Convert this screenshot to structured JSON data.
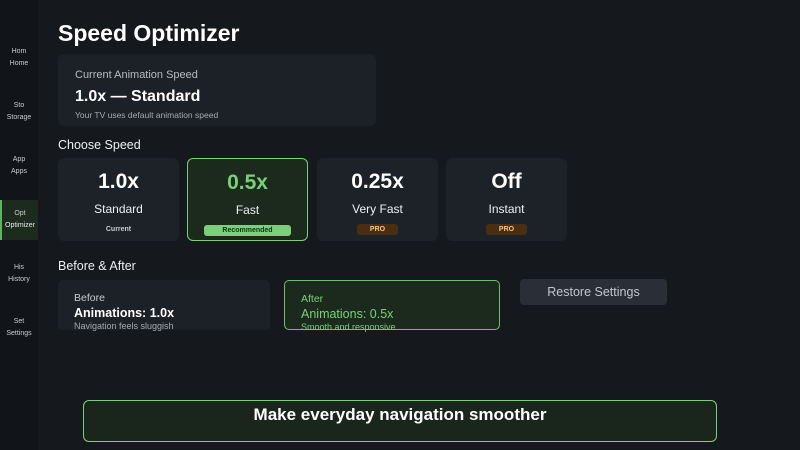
{
  "sidebar": {
    "items": [
      {
        "icon": "Hom",
        "label": "Home",
        "active": false
      },
      {
        "icon": "Sto",
        "label": "Storage",
        "active": false
      },
      {
        "icon": "App",
        "label": "Apps",
        "active": false
      },
      {
        "icon": "Opt",
        "label": "Optimizer",
        "active": true
      },
      {
        "icon": "His",
        "label": "History",
        "active": false
      },
      {
        "icon": "Set",
        "label": "Settings",
        "active": false
      }
    ]
  },
  "page_title": "Speed Optimizer",
  "current": {
    "label": "Current Animation Speed",
    "value": "1.0x — Standard",
    "sub": "Your TV uses default animation speed"
  },
  "choose_speed": {
    "title": "Choose Speed",
    "options": [
      {
        "value": "1.0x",
        "name": "Standard",
        "tag": "Current"
      },
      {
        "value": "0.5x",
        "name": "Fast",
        "tag": "Recommended"
      },
      {
        "value": "0.25x",
        "name": "Very Fast",
        "tag": "PRO"
      },
      {
        "value": "Off",
        "name": "Instant",
        "tag": "PRO"
      }
    ]
  },
  "before_after": {
    "title": "Before & After",
    "before": {
      "heading": "Before",
      "value": "Animations: 1.0x",
      "desc": "Navigation feels sluggish"
    },
    "after": {
      "heading": "After",
      "value": "Animations: 0.5x",
      "desc": "Smooth and responsive"
    }
  },
  "restore_label": "Restore Settings",
  "banner": "Make everyday navigation smoother",
  "colors": {
    "accent": "#7ad07a",
    "background": "#15181d",
    "card": "#1d2128",
    "pro": "#4a2e12"
  }
}
